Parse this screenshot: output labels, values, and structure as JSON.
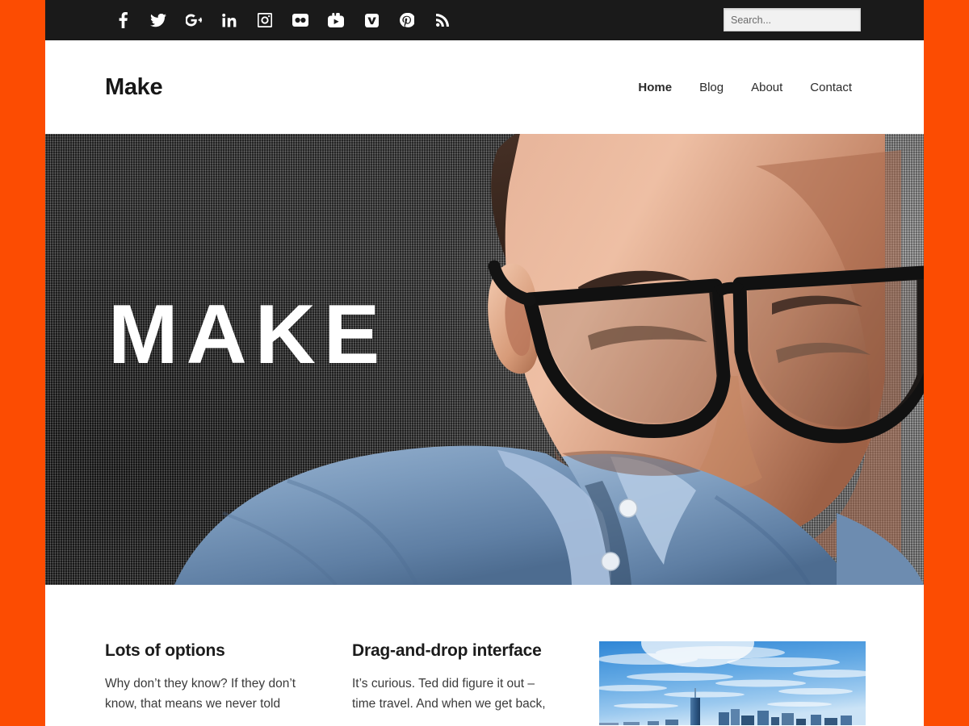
{
  "theme": {
    "frame_color": "#fc4c02",
    "topbar_color": "#1a1a1a",
    "page_background": "#ffffff",
    "text_color": "#1b1b1b"
  },
  "topbar": {
    "social_links": [
      {
        "name": "facebook",
        "label": "Facebook"
      },
      {
        "name": "twitter",
        "label": "Twitter"
      },
      {
        "name": "google-plus",
        "label": "Google+"
      },
      {
        "name": "linkedin",
        "label": "LinkedIn"
      },
      {
        "name": "instagram",
        "label": "Instagram"
      },
      {
        "name": "flickr",
        "label": "Flickr"
      },
      {
        "name": "youtube",
        "label": "YouTube"
      },
      {
        "name": "vimeo",
        "label": "Vimeo"
      },
      {
        "name": "pinterest",
        "label": "Pinterest"
      },
      {
        "name": "rss",
        "label": "RSS"
      }
    ],
    "search": {
      "placeholder": "Search...",
      "value": ""
    }
  },
  "header": {
    "site_title": "Make",
    "nav": [
      {
        "label": "Home",
        "active": true
      },
      {
        "label": "Blog",
        "active": false
      },
      {
        "label": "About",
        "active": false
      },
      {
        "label": "Contact",
        "active": false
      }
    ]
  },
  "hero": {
    "title": "MAKE",
    "image_alt": "man-with-glasses-in-denim-shirt"
  },
  "features": [
    {
      "title": "Lots of options",
      "body": "Why don’t they know? If they don’t know, that means we never told"
    },
    {
      "title": "Drag-and-drop interface",
      "body": "It’s curious. Ted did figure it out – time travel. And when we get back,"
    },
    {
      "title": "",
      "body": "",
      "image_alt": "city-skyline-with-blue-sky"
    }
  ]
}
